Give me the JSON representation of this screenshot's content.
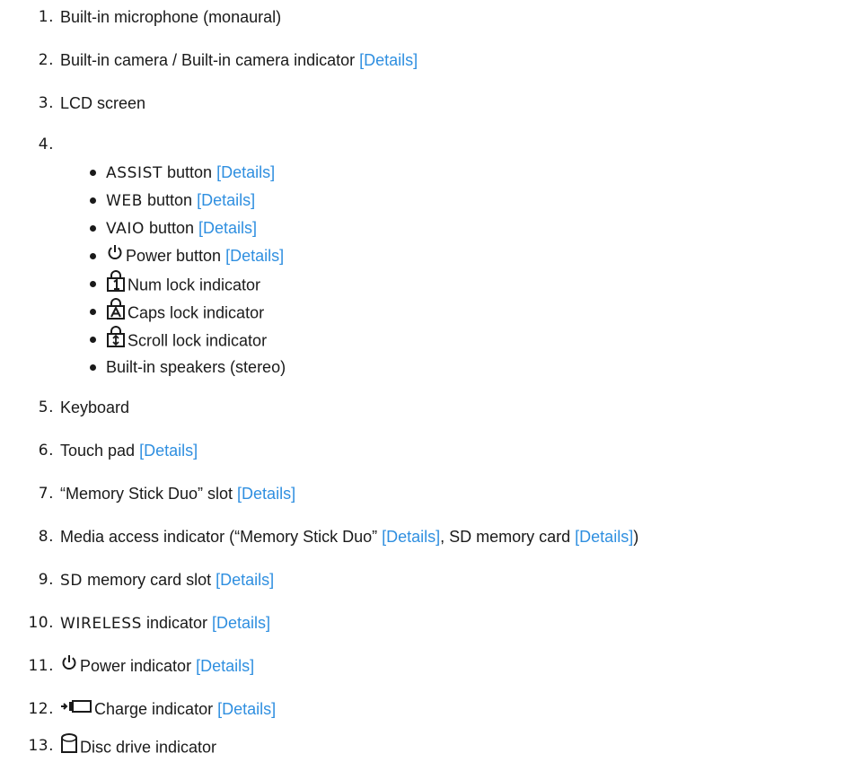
{
  "items": [
    {
      "num": "1.",
      "text": "Built-in microphone (monaural)"
    },
    {
      "num": "2.",
      "text": "Built-in camera / Built-in camera indicator ",
      "link": "[Details]"
    },
    {
      "num": "3.",
      "text": "LCD screen"
    },
    {
      "num": "4."
    },
    {
      "num": "5.",
      "text": "Keyboard"
    },
    {
      "num": "6.",
      "text": "Touch pad ",
      "link": "[Details]"
    },
    {
      "num": "7.",
      "text": "“Memory Stick Duo” slot ",
      "link": "[Details]"
    },
    {
      "num": "8.",
      "text_a": "Media access indicator (“Memory Stick Duo” ",
      "link_a": "[Details]",
      "text_b": ", SD memory card ",
      "link_b": "[Details]",
      "text_c": ")"
    },
    {
      "num": "9.",
      "text_wide": "SD",
      "text": " memory card slot ",
      "link": "[Details]"
    },
    {
      "num": "10.",
      "text_wide": "WIRELESS",
      "text": " indicator ",
      "link": "[Details]"
    },
    {
      "num": "11.",
      "icon": "power-icon",
      "text": "Power indicator ",
      "link": "[Details]"
    },
    {
      "num": "12.",
      "icon": "charge-icon",
      "text": "Charge indicator ",
      "link": "[Details]"
    },
    {
      "num": "13.",
      "icon": "disc-drive-icon",
      "text": "Disc drive indicator"
    }
  ],
  "sub_items": [
    {
      "text_wide": "ASSIST",
      "text": " button ",
      "link": "[Details]"
    },
    {
      "text_wide": "WEB",
      "text": " button ",
      "link": "[Details]"
    },
    {
      "text_wide": "VAIO",
      "text": " button ",
      "link": "[Details]"
    },
    {
      "icon": "power-icon",
      "text": "Power button ",
      "link": "[Details]"
    },
    {
      "icon": "num-lock-icon",
      "text": "Num lock indicator"
    },
    {
      "icon": "caps-lock-icon",
      "text": "Caps lock indicator"
    },
    {
      "icon": "scroll-lock-icon",
      "text": "Scroll lock indicator"
    },
    {
      "text": "Built-in speakers (stereo)"
    }
  ],
  "colors": {
    "link": "#2f8fe0",
    "text": "#1a1a1a"
  }
}
